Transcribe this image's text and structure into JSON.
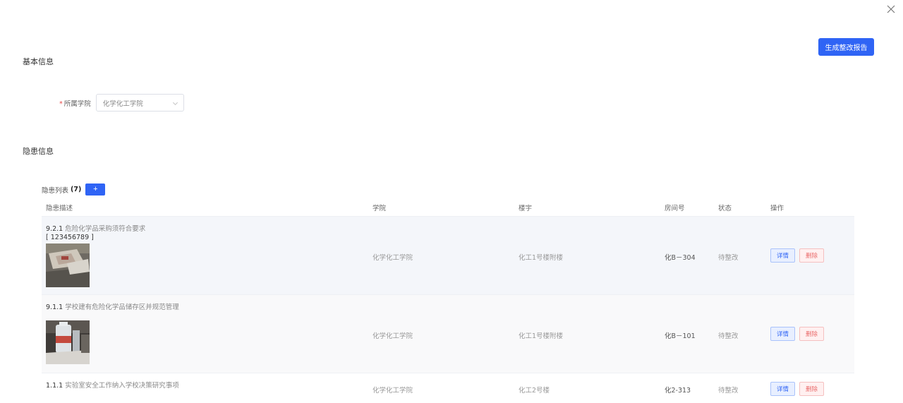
{
  "header": {
    "generate_report_label": "生成整改报告"
  },
  "sections": {
    "basic_info": "基本信息",
    "hazard_info": "隐患信息"
  },
  "form": {
    "college_label": "所属学院",
    "required_mark": "*",
    "college_value": "化学化工学院"
  },
  "list": {
    "title": "隐患列表",
    "count": "(7)",
    "add_label": "+",
    "columns": [
      "隐患描述",
      "学院",
      "楼宇",
      "房间号",
      "状态",
      "操作"
    ],
    "rows": [
      {
        "code": "9.2.1",
        "description": "危险化学品采购须符合要求",
        "tag": "[ 123456789 ]",
        "college": "化学化工学院",
        "building": "化工1号楼附楼",
        "room": "化B－304",
        "status": "待整改",
        "detail_label": "详情",
        "delete_label": "删除"
      },
      {
        "code": "9.1.1",
        "description": "学校建有危险化学品储存区并规范管理",
        "tag": "",
        "college": "化学化工学院",
        "building": "化工1号楼附楼",
        "room": "化B－101",
        "status": "待整改",
        "detail_label": "详情",
        "delete_label": "删除"
      },
      {
        "code": "1.1.1",
        "description": "实验室安全工作纳入学校决策研究事项",
        "tag": "",
        "college": "化学化工学院",
        "building": "化工2号楼",
        "room": "化2-313",
        "status": "待整改",
        "detail_label": "详情",
        "delete_label": "删除"
      }
    ]
  },
  "colors": {
    "primary": "#2f64f5",
    "danger": "#ea6b6b",
    "required": "#e94b4b"
  }
}
